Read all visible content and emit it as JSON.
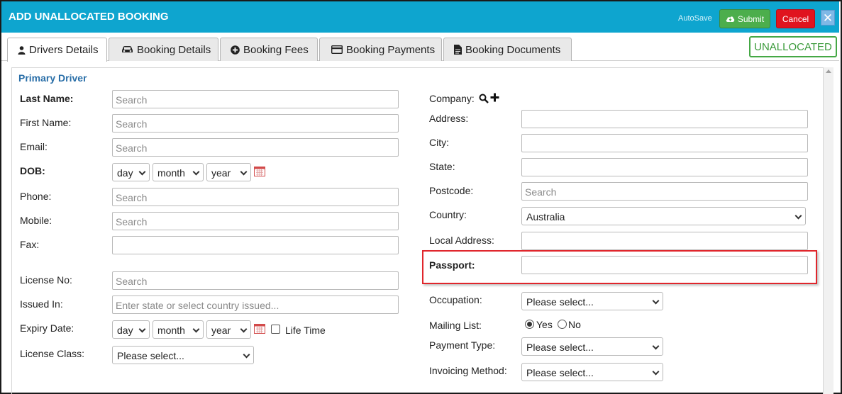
{
  "window": {
    "title": "ADD UNALLOCATED BOOKING",
    "autosave_label": "AutoSave",
    "submit_label": "Submit",
    "cancel_label": "Cancel",
    "close_glyph": "✕"
  },
  "status_badge": "UNALLOCATED",
  "tabs": [
    {
      "label": "Drivers Details",
      "icon": "user-icon",
      "active": true
    },
    {
      "label": "Booking Details",
      "icon": "car-icon"
    },
    {
      "label": "Booking Fees",
      "icon": "plus-circle-icon"
    },
    {
      "label": "Booking Payments",
      "icon": "credit-card-icon"
    },
    {
      "label": "Booking Documents",
      "icon": "document-icon"
    }
  ],
  "section_title": "Primary Driver",
  "left": {
    "last_name": {
      "label": "Last Name:",
      "placeholder": "Search"
    },
    "first_name": {
      "label": "First Name:",
      "placeholder": "Search"
    },
    "email": {
      "label": "Email:",
      "placeholder": "Search"
    },
    "dob": {
      "label": "DOB:",
      "day": "day",
      "month": "month",
      "year": "year"
    },
    "phone": {
      "label": "Phone:",
      "placeholder": "Search"
    },
    "mobile": {
      "label": "Mobile:",
      "placeholder": "Search"
    },
    "fax": {
      "label": "Fax:",
      "placeholder": ""
    },
    "license_no": {
      "label": "License No:",
      "placeholder": "Search"
    },
    "issued_in": {
      "label": "Issued In:",
      "placeholder": "Enter state or select country issued..."
    },
    "expiry_date": {
      "label": "Expiry Date:",
      "day": "day",
      "month": "month",
      "year": "year",
      "life_time_label": "Life Time"
    },
    "license_class": {
      "label": "License Class:",
      "value": "Please select..."
    }
  },
  "right": {
    "company": {
      "label": "Company:"
    },
    "address": {
      "label": "Address:"
    },
    "city": {
      "label": "City:"
    },
    "state": {
      "label": "State:"
    },
    "postcode": {
      "label": "Postcode:",
      "placeholder": "Search"
    },
    "country": {
      "label": "Country:",
      "value": "Australia"
    },
    "local_address": {
      "label": "Local Address:"
    },
    "passport": {
      "label": "Passport:"
    },
    "occupation": {
      "label": "Occupation:",
      "value": "Please select..."
    },
    "mailing_list": {
      "label": "Mailing List:",
      "yes": "Yes",
      "no": "No",
      "selected": "Yes"
    },
    "payment_type": {
      "label": "Payment Type:",
      "value": "Please select..."
    },
    "invoicing_method": {
      "label": "Invoicing Method:",
      "value": "Please select..."
    }
  },
  "colors": {
    "header": "#0ea5cf",
    "submit": "#4cae4c",
    "cancel": "#e0141e",
    "status_green": "#45a845",
    "section_blue": "#2a6fa8",
    "highlight_red": "#e0262c"
  }
}
